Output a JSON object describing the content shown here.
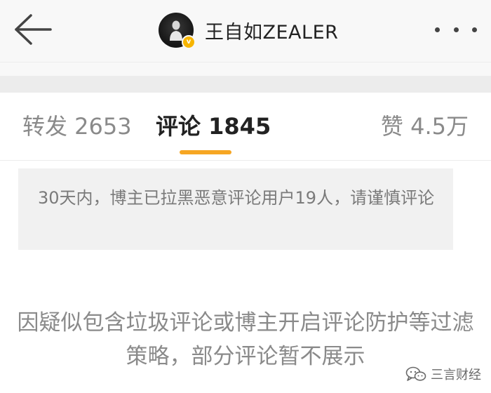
{
  "header": {
    "back_icon": "arrow-left-icon",
    "profile_name": "王自如ZEALER",
    "verified_icon": "verified-badge-icon",
    "verified_glyph": "v",
    "more_icon": "more-dots-icon"
  },
  "tabs": [
    {
      "label": "转发 2653",
      "active": false
    },
    {
      "label": "评论 1845",
      "active": true
    },
    {
      "label": "赞 4.5万",
      "active": false
    }
  ],
  "colors": {
    "accent": "#f6a623",
    "verified": "#f7b500",
    "muted_text": "#8a8a8a"
  },
  "notice": {
    "text": "30天内，博主已拉黑恶意评论用户19人，请谨慎评论"
  },
  "filter_message": {
    "text": "因疑似包含垃圾评论或博主开启评论防护等过滤策略，部分评论暂不展示"
  },
  "watermark": {
    "icon": "wechat-icon",
    "text": "三言财经"
  }
}
